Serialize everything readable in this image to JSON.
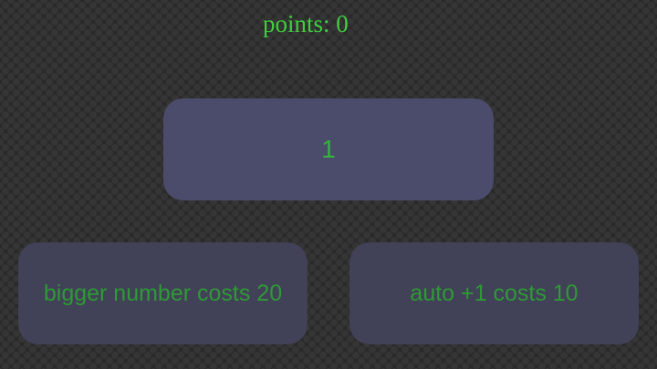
{
  "score": {
    "label": "points:",
    "value": "0"
  },
  "main_button": {
    "label": "1"
  },
  "upgrades": [
    {
      "label": "bigger number costs 20"
    },
    {
      "label": "auto +1 costs 10"
    }
  ],
  "colors": {
    "background": "#2a2a2a",
    "text_green": "#3fcf3f",
    "main_button_bg": "#4b4b6b",
    "upgrade_button_bg": "#414157"
  }
}
